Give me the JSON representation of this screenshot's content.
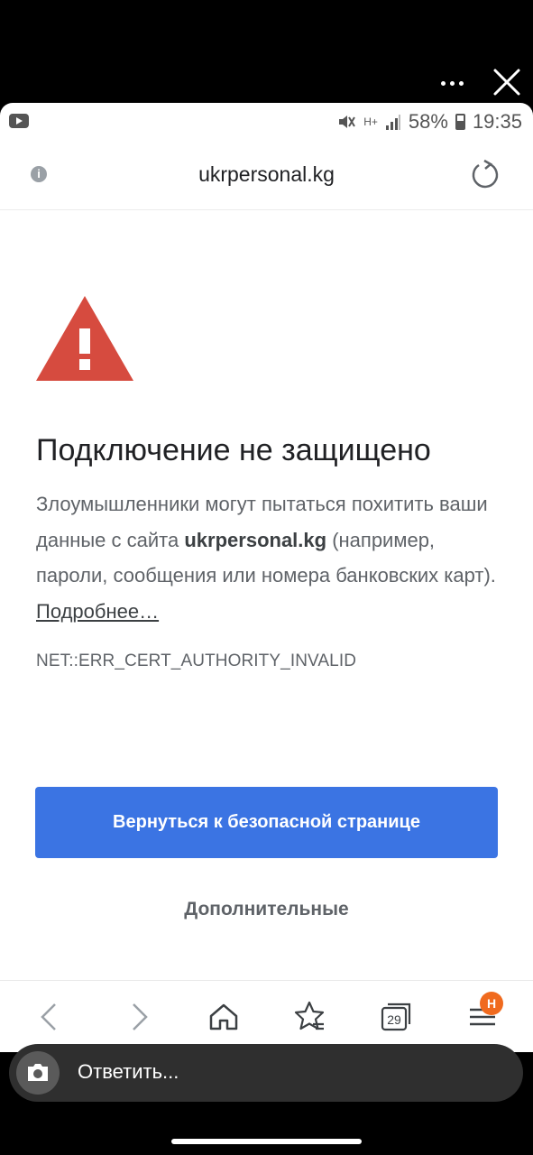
{
  "overlay": {
    "more_icon": "more-horizontal-icon",
    "close_icon": "close-icon"
  },
  "status_bar": {
    "battery": "58%",
    "time": "19:35",
    "network": "H+"
  },
  "browser": {
    "url": "ukrpersonal.kg",
    "info_icon": "i"
  },
  "error_page": {
    "heading": "Подключение не защищено",
    "desc_part1": "Злоумышленники могут пытаться похитить ваши данные с сайта ",
    "desc_site": "ukrpersonal.kg",
    "desc_part2": " (например, пароли, сообщения или номера банковских карт). ",
    "learn_more": "Подробнее…",
    "error_code": "NET::ERR_CERT_AUTHORITY_INVALID",
    "back_button": "Вернуться к безопасной странице",
    "advanced_button": "Дополнительные",
    "accent_color": "#3b74e3",
    "warning_color": "#d64b3f"
  },
  "bottom_nav": {
    "tab_count": "29",
    "menu_badge": "H"
  },
  "reply_bar": {
    "placeholder": "Ответить..."
  }
}
